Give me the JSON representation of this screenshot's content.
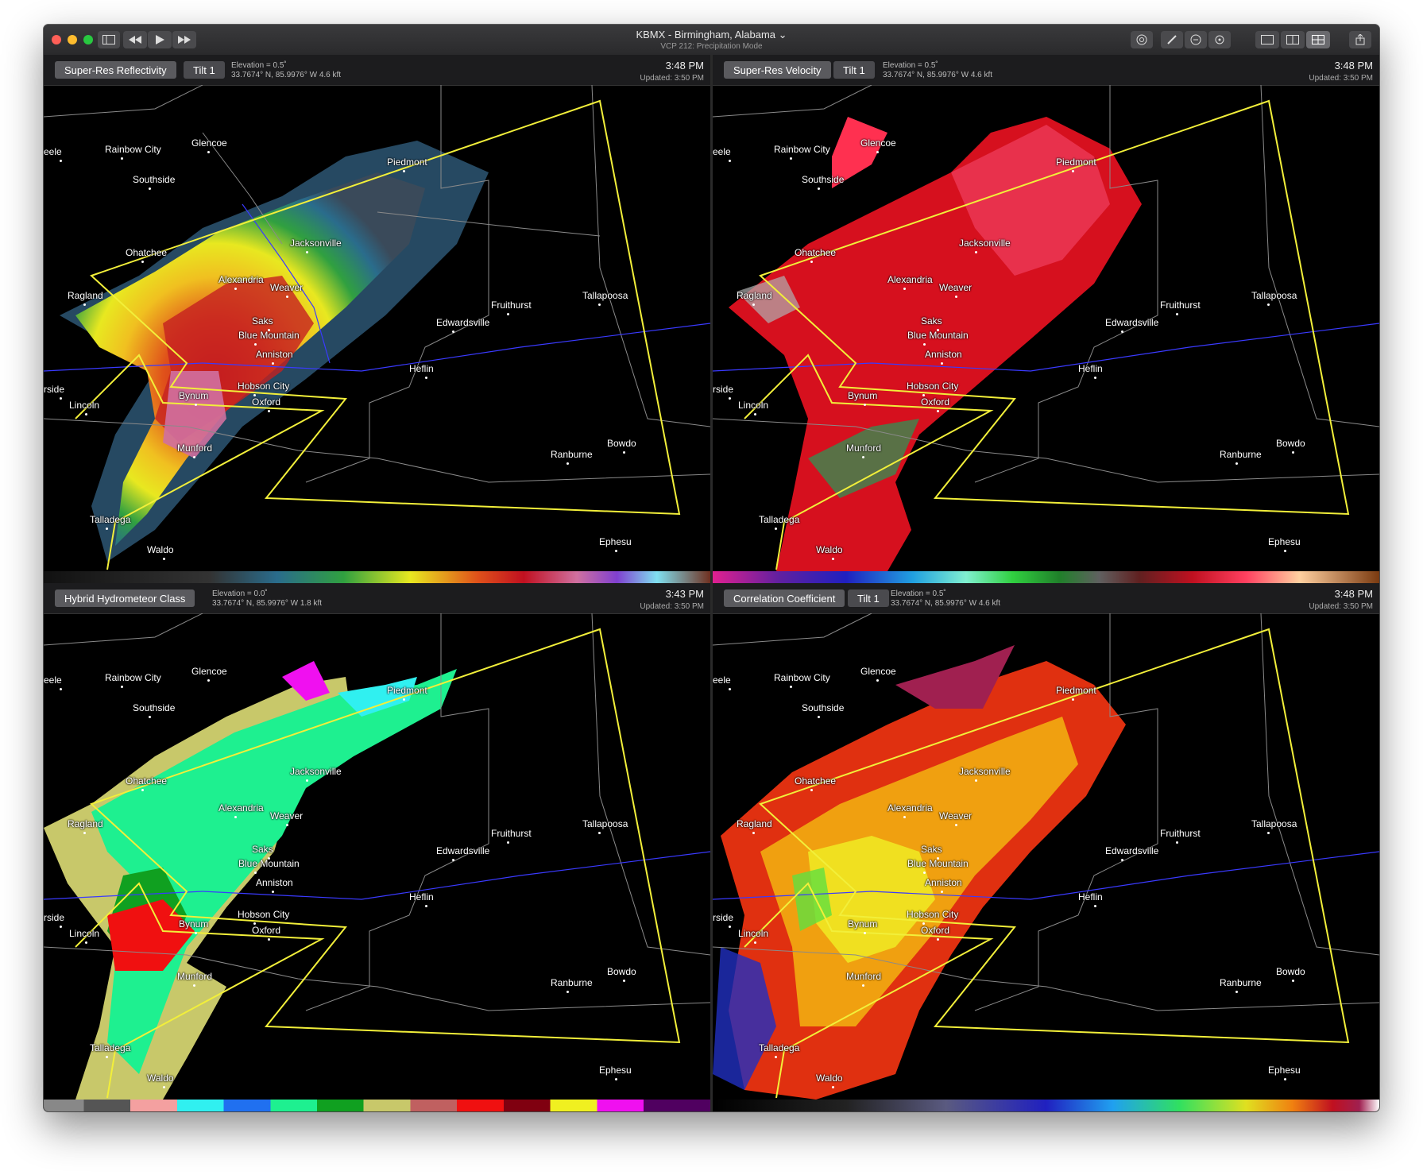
{
  "window": {
    "title": "KBMX - Birmingham, Alabama",
    "subtitle": "VCP 212: Precipitation Mode"
  },
  "toolbar": {
    "icons": [
      "sidebar-icon",
      "rewind-icon",
      "play-icon",
      "fast-forward-icon",
      "target-icon",
      "pencil-icon",
      "minus-circle-icon",
      "crosshair-icon",
      "single-layout-icon",
      "dual-layout-icon",
      "quad-layout-icon",
      "share-icon"
    ]
  },
  "panels": [
    {
      "product": "Super-Res Reflectivity",
      "tilt": "Tilt 1",
      "elevation": "Elevation = 0.5˚",
      "coords": "33.7674° N, 85.9976° W 4.6 kft",
      "time": "3:48 PM",
      "updated": "Updated: 3:50 PM"
    },
    {
      "product": "Super-Res Velocity",
      "tilt": "Tilt 1",
      "elevation": "Elevation = 0.5˚",
      "coords": "33.7674° N, 85.9976° W 4.6 kft",
      "time": "3:48 PM",
      "updated": "Updated: 3:50 PM"
    },
    {
      "product": "Hybrid Hydrometeor Class",
      "tilt": "",
      "elevation": "Elevation = 0.0˚",
      "coords": "33.7674° N, 85.9976° W 1.8 kft",
      "time": "3:43 PM",
      "updated": "Updated: 3:50 PM"
    },
    {
      "product": "Correlation Coefficient",
      "tilt": "Tilt 1",
      "elevation": "Elevation = 0.5˚",
      "coords": "33.7674° N, 85.9976° W 4.6 kft",
      "time": "3:48 PM",
      "updated": "Updated: 3:50 PM"
    }
  ],
  "cities": [
    "Rainbow City",
    "Glencoe",
    "Southside",
    "Piedmont",
    "Ohatchee",
    "Jacksonville",
    "Alexandria",
    "Weaver",
    "Ragland",
    "Tallapoosa",
    "Fruithurst",
    "Edwardsville",
    "Saks",
    "Blue Mountain",
    "Anniston",
    "Heflin",
    "Hobson City",
    "Bynum",
    "Oxford",
    "Lincoln",
    "Munford",
    "Ranburne",
    "Bowdo",
    "Talladega",
    "Waldo",
    "Ephesu",
    "rside",
    "eele"
  ],
  "colors": {
    "warning_polygon": "#f2ef3a",
    "county_lines": "#8a8a8a",
    "rivers": "#3a3aff"
  }
}
